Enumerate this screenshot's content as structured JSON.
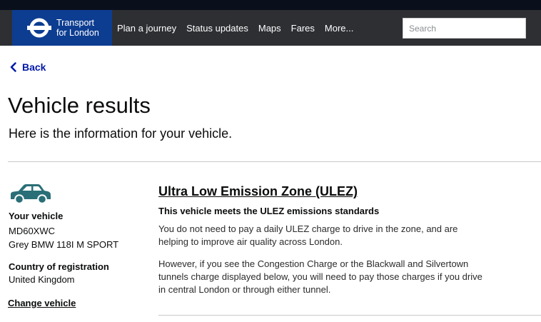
{
  "header": {
    "brand_line1": "Transport",
    "brand_line2": "for London",
    "nav": [
      "Plan a journey",
      "Status updates",
      "Maps",
      "Fares",
      "More..."
    ],
    "search_placeholder": "Search"
  },
  "back_label": "Back",
  "page_title": "Vehicle results",
  "subtitle": "Here is the information for your vehicle.",
  "vehicle": {
    "heading": "Your vehicle",
    "registration": "MD60XWC",
    "description": "Grey BMW 118I M SPORT",
    "country_heading": "Country of registration",
    "country": "United Kingdom",
    "change_label": "Change vehicle"
  },
  "ulez": {
    "heading": "Ultra Low Emission Zone (ULEZ)",
    "status": "This vehicle meets the ULEZ emissions standards",
    "para1": "You do not need to pay a daily ULEZ charge to drive in the zone, and are helping to improve air quality across London.",
    "para2": "However, if you see the Congestion Charge or the Blackwall and Silvertown tunnels charge displayed below, you will need to pay those charges if you drive in central London or through either tunnel."
  },
  "colors": {
    "brand_blue": "#0d3d91",
    "navbar": "#2d2f33",
    "link_blue": "#0019a8",
    "car_teal": "#2a6f77"
  }
}
